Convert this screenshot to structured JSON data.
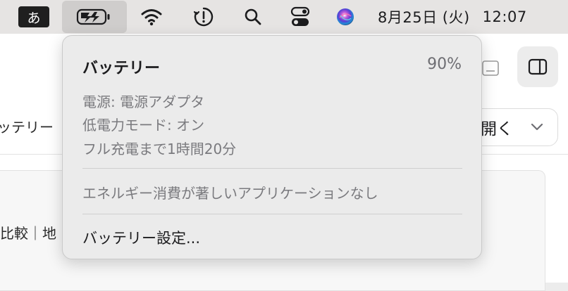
{
  "menubar": {
    "ime_label": "あ",
    "date": "8月25日 (火)",
    "time": "12:07",
    "icons": {
      "battery": "battery-charging-icon",
      "wifi": "wifi-icon",
      "alert": "alert-circle-icon",
      "search": "search-icon",
      "control_center": "control-center-icon",
      "siri": "siri-icon"
    }
  },
  "background": {
    "left_label": "ッテリー",
    "compare_label": "比較｜地",
    "open_label": "開く"
  },
  "popover": {
    "title": "バッテリー",
    "percentage": "90%",
    "power_source": "電源: 電源アダプタ",
    "low_power_mode": "低電力モード: オン",
    "time_to_full": "フル充電まで1時間20分",
    "no_apps_message": "エネルギー消費が著しいアプリケーションなし",
    "settings_label": "バッテリー設定..."
  }
}
